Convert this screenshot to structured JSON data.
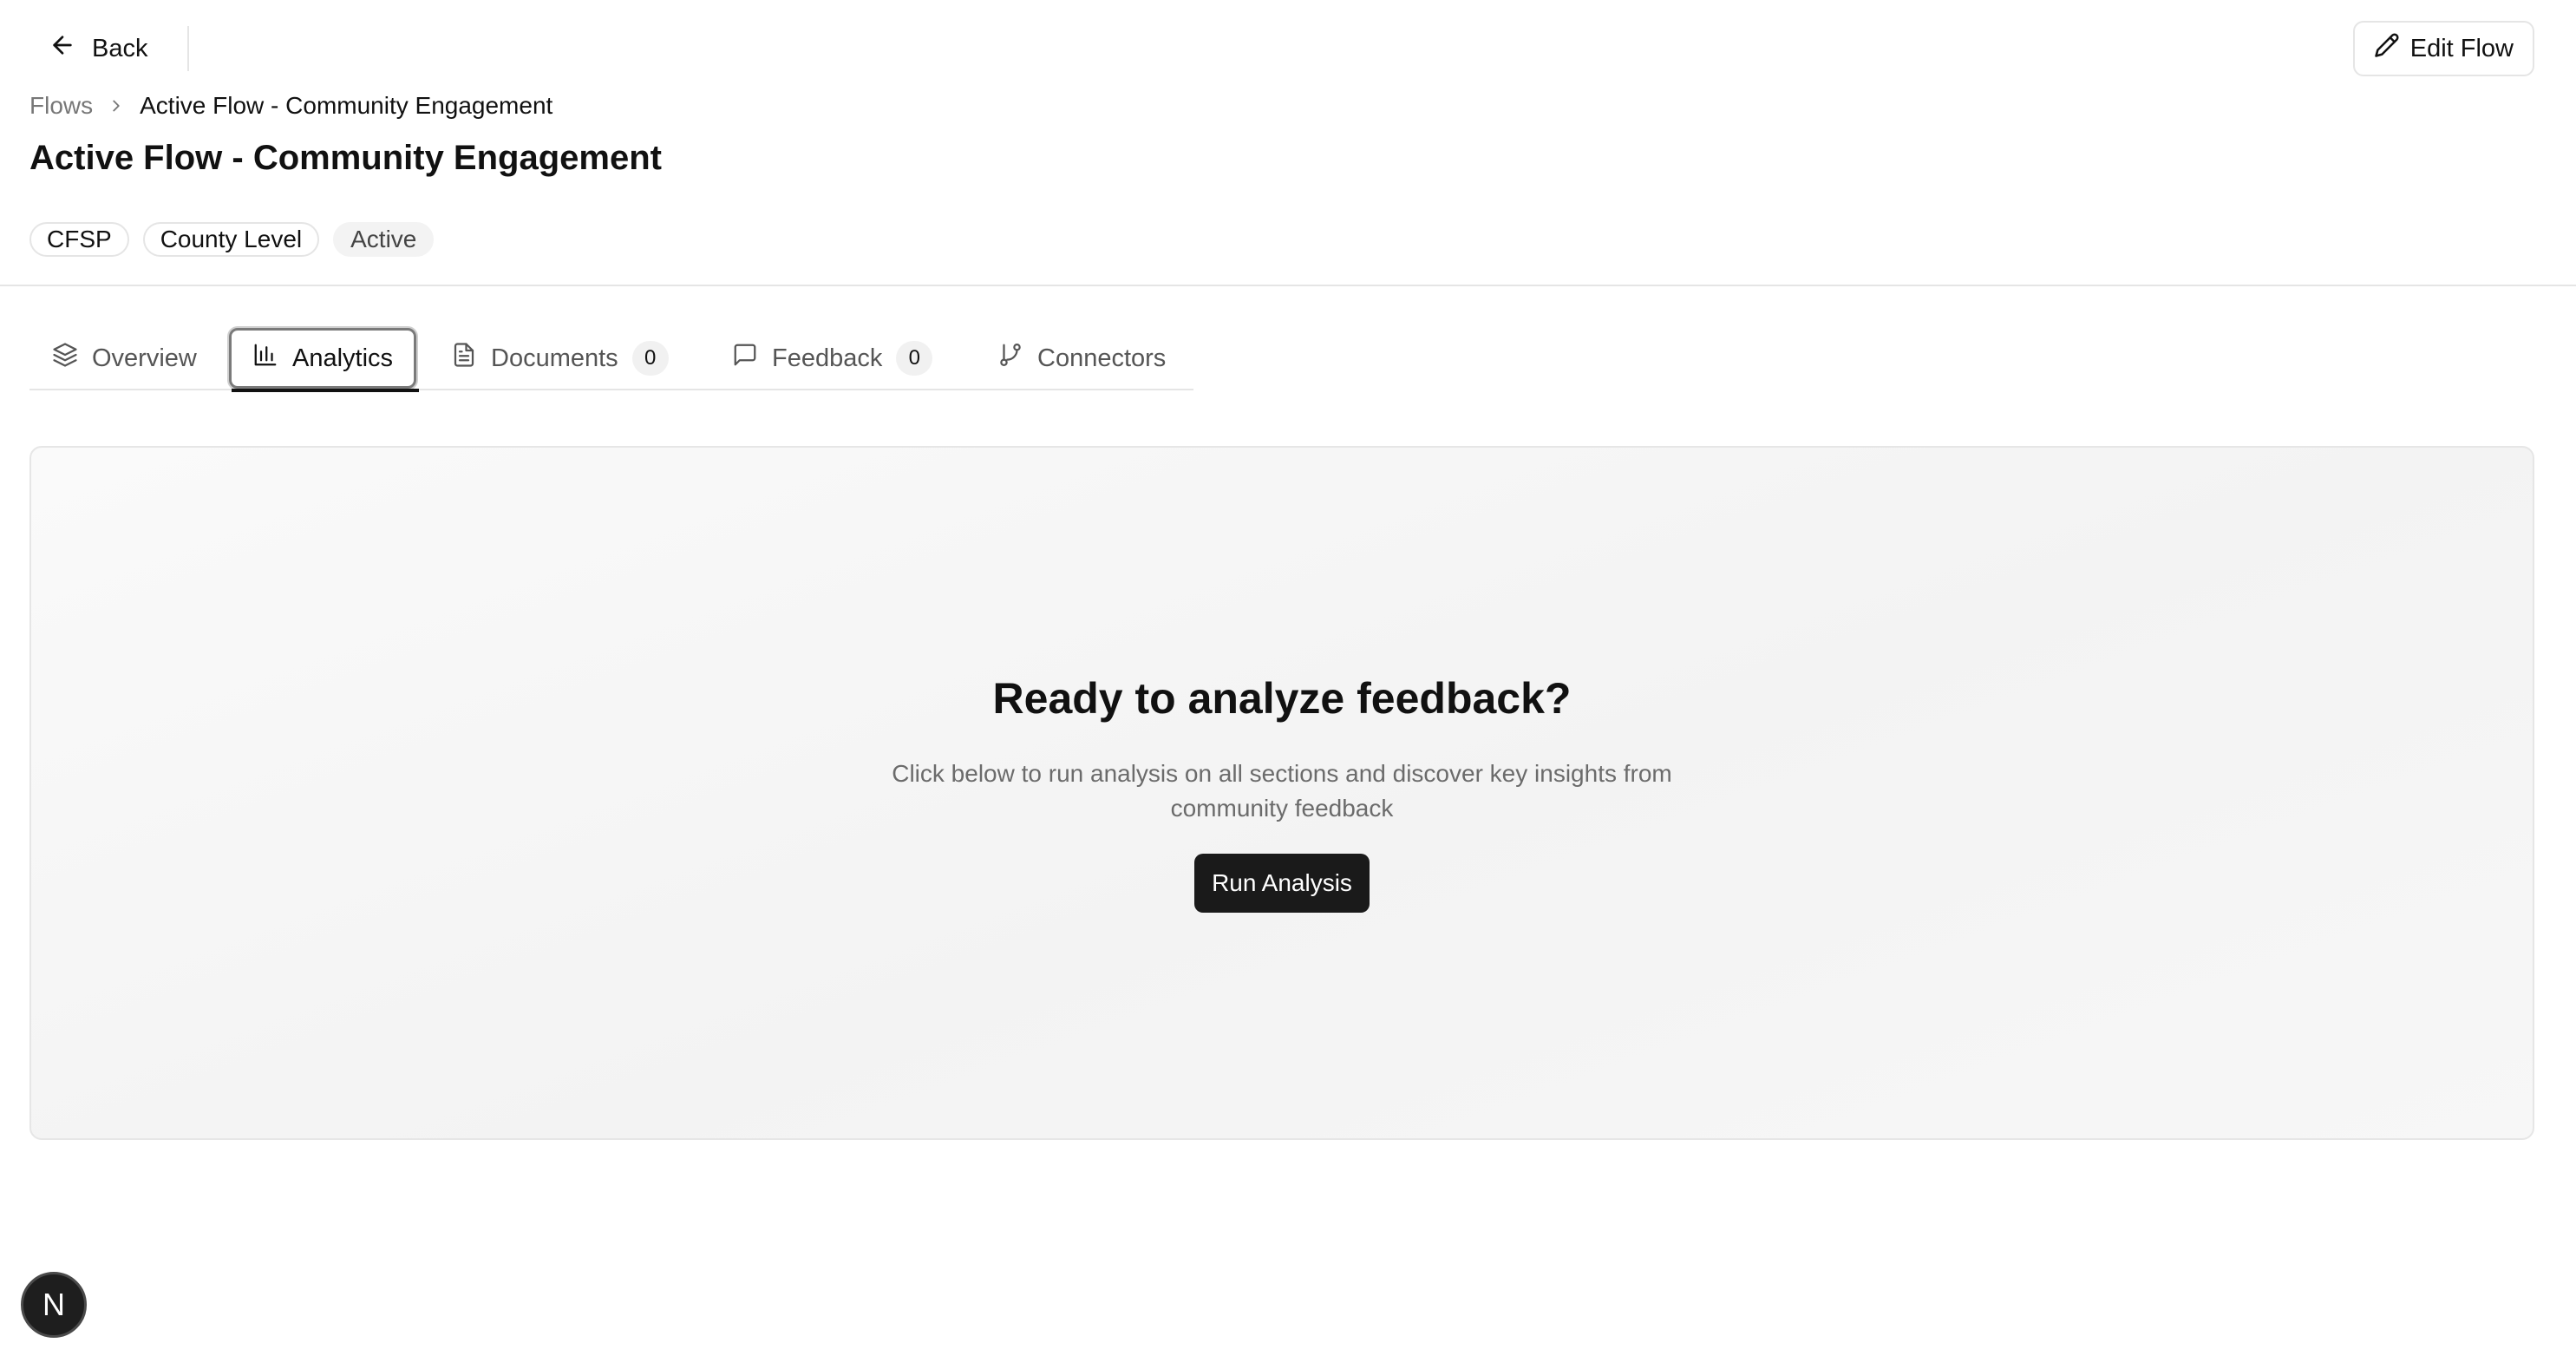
{
  "topbar": {
    "back_label": "Back",
    "edit_label": "Edit Flow"
  },
  "breadcrumb": {
    "root": "Flows",
    "current": "Active Flow - Community Engagement"
  },
  "page": {
    "title": "Active Flow - Community Engagement"
  },
  "badges": [
    "CFSP",
    "County Level",
    "Active"
  ],
  "tabs": [
    {
      "label": "Overview",
      "icon": "layers-icon"
    },
    {
      "label": "Analytics",
      "icon": "bar-chart-icon",
      "active": true
    },
    {
      "label": "Documents",
      "icon": "document-icon",
      "count": "0"
    },
    {
      "label": "Feedback",
      "icon": "message-icon",
      "count": "0"
    },
    {
      "label": "Connectors",
      "icon": "git-branch-icon"
    }
  ],
  "empty_state": {
    "title": "Ready to analyze feedback?",
    "description": "Click below to run analysis on all sections and discover key insights from community feedback",
    "button_label": "Run Analysis"
  },
  "fab": {
    "letter": "N"
  },
  "colors": {
    "primary_button": "#1a1a1a",
    "border": "#e5e5e5",
    "muted_text": "#6b6b6b"
  }
}
